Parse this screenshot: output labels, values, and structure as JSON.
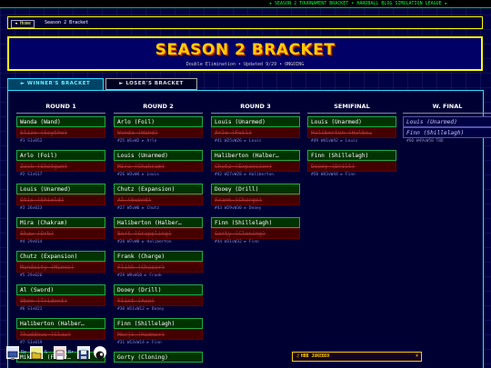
{
  "ticker": {
    "text": "★ SEASON 2 TOURNAMENT BRACKET • HARDBALL BLOG SIMULATION LEAGUE ★"
  },
  "breadcrumb": {
    "home": "◄ Home",
    "current": "Season 2 Bracket"
  },
  "header": {
    "title": "SEASON 2 BRACKET",
    "subtitle": "Double Elimination • Updated 9/29 •   ONGOING"
  },
  "tabs": [
    {
      "label": "► WINNER'S BRACKET",
      "active": true
    },
    {
      "label": "► LOSER'S BRACKET",
      "active": false
    }
  ],
  "rounds": [
    {
      "title": "ROUND 1",
      "matches": [
        {
          "winner": "Wanda (Wand)",
          "loser": "Slize (Scythe)",
          "meta": "#1 S1v052"
        },
        {
          "winner": "Arlo (Foil)",
          "loser": "Zack (Shotgun)",
          "meta": "#2 S1v617"
        },
        {
          "winner": "Louis (Unarmed)",
          "loser": "Otis (Shield)",
          "meta": "#3 26v023"
        },
        {
          "winner": "Mira (Chakram)",
          "loser": "Shaw (Orb)",
          "meta": "#4 29v014"
        },
        {
          "winner": "Chutz (Expansion)",
          "loser": "Mandeity (Mines)",
          "meta": "#5 29v026"
        },
        {
          "winner": "Al (Sword)",
          "loser": "Obee (Trident)",
          "meta": "#6 S1v021"
        },
        {
          "winner": "Haliberton (Halber…",
          "loser": "Thaddeus (Claw)",
          "meta": "#7 S1v019"
        },
        {
          "winner": "Mikhail (Fiber…",
          "loser": "",
          "meta": ""
        }
      ]
    },
    {
      "title": "ROUND 2",
      "matches": [
        {
          "winner": "Arlo (Foil)",
          "loser": "Wanda (Wand)",
          "meta": "#25 W1vW2 ► Arlo"
        },
        {
          "winner": "Louis (Unarmed)",
          "loser": "Mira (Chakram)",
          "meta": "#26 W3vW4 ► Louis"
        },
        {
          "winner": "Chutz (Expansion)",
          "loser": "Al (Sword)",
          "meta": "#27 W5vW6 ► Chutz"
        },
        {
          "winner": "Haliberton (Halber…",
          "loser": "Bort (Grappling)",
          "meta": "#28 W7vW8 ► Haliberton"
        },
        {
          "winner": "Frank (Charge)",
          "loser": "Flikk (Chaser)",
          "meta": "#29 W9vW10 ► Frank"
        },
        {
          "winner": "Dooey (Drill)",
          "loser": "Flint (Axe)",
          "meta": "#30 W11vW12 ► Dooey"
        },
        {
          "winner": "Finn (Shillelagh)",
          "loser": "Merji (Hammer)",
          "meta": "#31 W13vW14 ► Finn"
        },
        {
          "winner": "Gorty (Cloning)",
          "loser": "",
          "meta": ""
        }
      ]
    },
    {
      "title": "ROUND 3",
      "matches": [
        {
          "winner": "Louis (Unarmed)",
          "loser": "Arlo (Foil)",
          "meta": "#41 W25vW26 ► Louis"
        },
        {
          "winner": "Haliberton (Halber…",
          "loser": "Chutz (Expansion)",
          "meta": "#42 W27vW28 ► Haliberton"
        },
        {
          "winner": "Dooey (Drill)",
          "loser": "Frank (Charge)",
          "meta": "#43 W29vW30 ► Dooey"
        },
        {
          "winner": "Finn (Shillelagh)",
          "loser": "Gorty (Cloning)",
          "meta": "#44 W31vW32 ► Finn"
        }
      ]
    },
    {
      "title": "SEMIFINAL",
      "matches": [
        {
          "winner": "Louis (Unarmed)",
          "loser": "Haliberton (Halbe…",
          "meta": "#49 W41vW42 ► Louis"
        },
        {
          "winner": "Finn (Shillelagh)",
          "loser": "Dooey (Drill)",
          "meta": "#50 W43vW44 ► Finn"
        }
      ]
    },
    {
      "title": "W. FINAL",
      "matches": [
        {
          "pending_a": "Louis (Unarmed)",
          "pending_b": "Finn (Shillelagh)",
          "meta": "#60 W49vW50 TBD"
        }
      ]
    }
  ],
  "jukebox": {
    "label": "HBB JUKEBOX",
    "icon": "music-note-icon",
    "close": "×"
  },
  "taskbar": {
    "labels": [
      "Re",
      "S",
      "Br"
    ]
  },
  "colors": {
    "accent": "#ffff00",
    "winner_border": "#22aa44",
    "loser_bg": "#440000",
    "tab_active": "#33ddff"
  }
}
